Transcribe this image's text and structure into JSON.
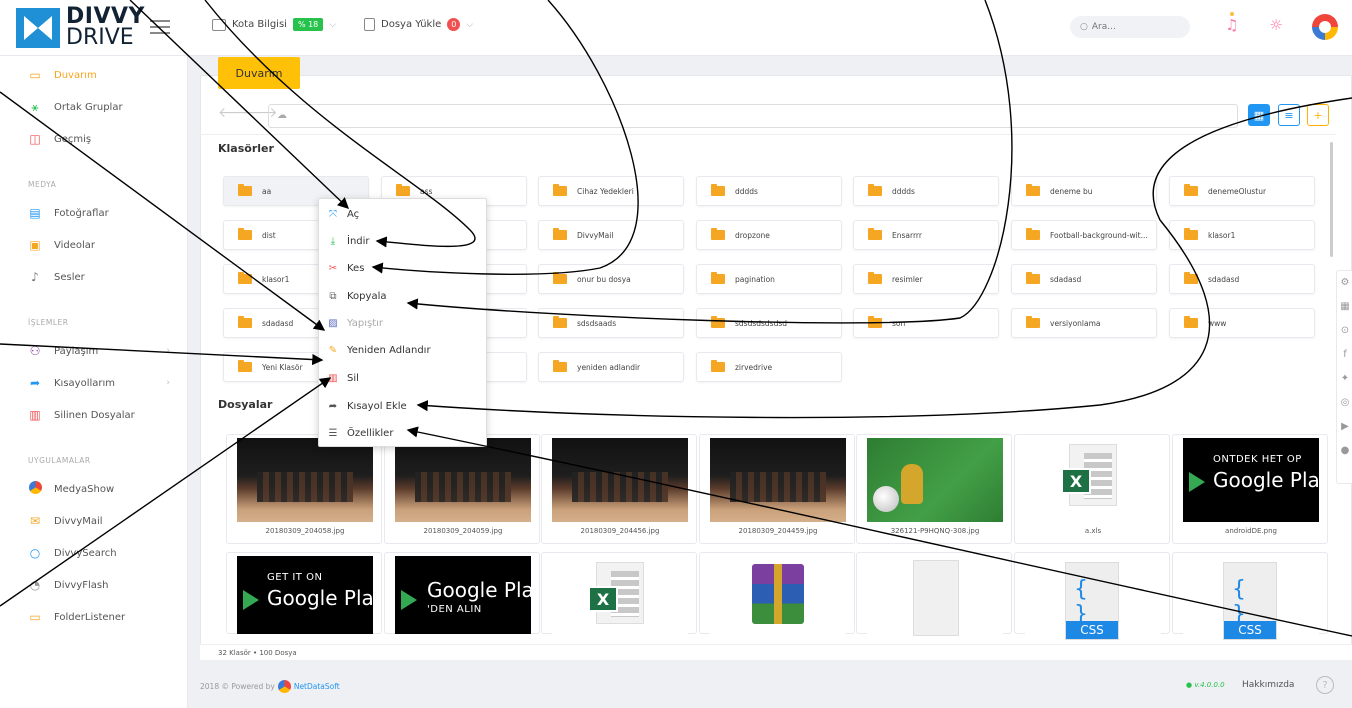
{
  "brand": {
    "line1": "DIVVY",
    "line2": "DRIVE"
  },
  "topbar": {
    "quota_label": "Kota Bilgisi",
    "quota_badge": "% 18",
    "upload_label": "Dosya Yükle",
    "upload_badge": "0",
    "search_placeholder": "Ara..."
  },
  "sidebar": {
    "main": [
      {
        "label": "Duvarım",
        "icon": "folder-icon",
        "active": true
      },
      {
        "label": "Ortak Gruplar",
        "icon": "network-icon"
      },
      {
        "label": "Geçmiş",
        "icon": "chart-icon"
      }
    ],
    "media_title": "MEDYA",
    "media": [
      {
        "label": "Fotoğraflar",
        "icon": "image-icon"
      },
      {
        "label": "Videolar",
        "icon": "video-icon"
      },
      {
        "label": "Sesler",
        "icon": "audio-icon"
      }
    ],
    "ops_title": "İŞLEMLER",
    "ops": [
      {
        "label": "Paylaşım",
        "icon": "share-icon"
      },
      {
        "label": "Kısayollarım",
        "icon": "shortcut-icon"
      },
      {
        "label": "Silinen Dosyalar",
        "icon": "trash-icon"
      }
    ],
    "apps_title": "UYGULAMALAR",
    "apps": [
      {
        "label": "MedyaShow",
        "icon": "medyashow-icon"
      },
      {
        "label": "DivvyMail",
        "icon": "mail-icon"
      },
      {
        "label": "DivvySearch",
        "icon": "search-icon"
      },
      {
        "label": "DivvyFlash",
        "icon": "flash-icon"
      },
      {
        "label": "FolderListener",
        "icon": "folder-listener-icon"
      }
    ]
  },
  "main": {
    "tab": "Duvarım",
    "folders_title": "Klasörler",
    "files_title": "Dosyalar",
    "folders": [
      "aa",
      "ass",
      "Cihaz Yedekleri",
      "dddds",
      "dddds",
      "deneme bu",
      "denemeOlustur",
      "dist",
      "",
      "DivvyMail",
      "dropzone",
      "Ensarrrr",
      "Football-background-wit...",
      "klasor1",
      "klasor1",
      "",
      "onur bu dosya",
      "pagination",
      "resimler",
      "sdadasd",
      "sdadasd",
      "sdadasd",
      "",
      "sdsdsaads",
      "sdsdsdsdsdsd",
      "son",
      "versiyonlama",
      "www",
      "Yeni Klasör",
      "...be",
      "yeniden adlandir",
      "zirvedrive"
    ],
    "files_row1": [
      "20180309_204058.jpg",
      "20180309_204059.jpg",
      "20180309_204456.jpg",
      "20180309_204459.jpg",
      "326121-P9HQNQ-308.jpg",
      "a.xls",
      "androidDE.png"
    ],
    "status": "32 Klasör  •  100 Dosya"
  },
  "google_play": {
    "small1": "ONTDEK HET OP",
    "big1": "Google Pla",
    "small2": "GET IT ON",
    "big2": "Google Pla",
    "big3": "Google Play",
    "small3": "'DEN ALIN"
  },
  "context_menu": [
    "Aç",
    "İndir",
    "Kes",
    "Kopyala",
    "Yapıştır",
    "Yeniden Adlandır",
    "Sil",
    "Kısayol Ekle",
    "Özellikler"
  ],
  "footer": {
    "copyright": "2018 © Powered by",
    "company": "NetDataSoft",
    "version": "● v.4.0.0.0",
    "about": "Hakkımızda",
    "help": "?"
  },
  "colors": {
    "accent": "#ffc107",
    "primary": "#2196f3",
    "folder": "#f5a623"
  }
}
